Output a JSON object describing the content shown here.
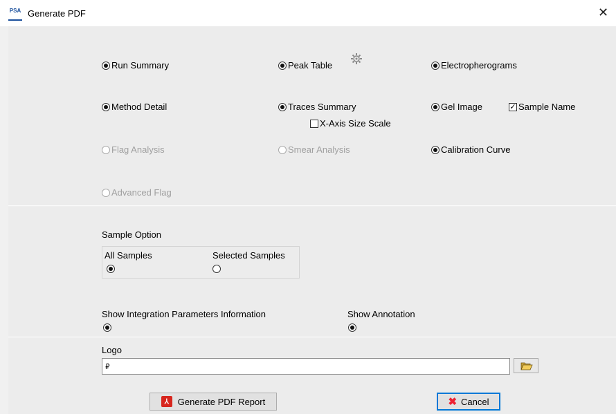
{
  "window": {
    "title": "Generate PDF",
    "app_icon": "PSA",
    "close_glyph": "✕"
  },
  "report_items": {
    "run_summary": "Run Summary",
    "peak_table": "Peak Table",
    "electropherograms": "Electropherograms",
    "method_detail": "Method Detail",
    "traces_summary": "Traces Summary",
    "gel_image": "Gel Image",
    "sample_name": "Sample Name",
    "x_axis_size_scale": "X-Axis Size Scale",
    "flag_analysis": "Flag Analysis",
    "smear_analysis": "Smear Analysis",
    "calibration_curve": "Calibration Curve",
    "advanced_flag": "Advanced Flag"
  },
  "sample_option": {
    "heading": "Sample Option",
    "all_samples": "All Samples",
    "selected_samples": "Selected Samples"
  },
  "show_integration": "Show Integration Parameters Information",
  "show_annotation": "Show Annotation",
  "logo": {
    "label": "Logo",
    "value": ""
  },
  "buttons": {
    "generate": "Generate PDF Report",
    "cancel": "Cancel"
  },
  "colors": {
    "accent": "#0078d7",
    "pdf_red": "#d7261e",
    "disabled_text": "#a0a0a0"
  }
}
